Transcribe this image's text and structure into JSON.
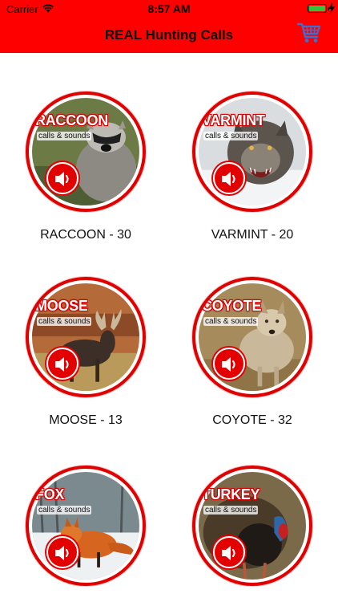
{
  "status_bar": {
    "carrier": "Carrier",
    "time": "8:57 AM",
    "battery_level": 0.9
  },
  "header": {
    "title": "REAL Hunting Calls",
    "background_color": "#fe0000",
    "cart_icon": "shopping-cart-icon"
  },
  "tiles": [
    {
      "title": "RACCOON",
      "subtitle": "calls & sounds",
      "caption": "RACCOON - 30"
    },
    {
      "title": "VARMINT",
      "subtitle": "calls & sounds",
      "caption": "VARMINT - 20"
    },
    {
      "title": "MOOSE",
      "subtitle": "calls & sounds",
      "caption": "MOOSE - 13"
    },
    {
      "title": "COYOTE",
      "subtitle": "calls & sounds",
      "caption": "COYOTE - 32"
    },
    {
      "title": "FOX",
      "subtitle": "calls & sounds",
      "caption": ""
    },
    {
      "title": "TURKEY",
      "subtitle": "calls & sounds",
      "caption": ""
    }
  ],
  "colors": {
    "accent_red": "#e30000",
    "cart_blue": "#3b6fd1"
  }
}
